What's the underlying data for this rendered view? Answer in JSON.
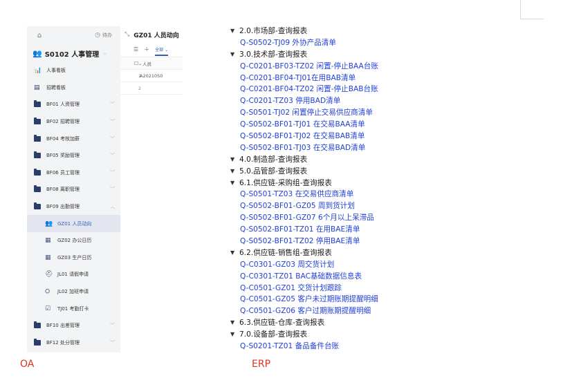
{
  "oa": {
    "todo_label": "待办",
    "system_title": "S0102 人事管理",
    "menu": [
      {
        "label": "人事看板",
        "icon": "chart-icon",
        "type": "top"
      },
      {
        "label": "招聘看板",
        "icon": "board-icon",
        "type": "top"
      },
      {
        "label": "BF01 人资管理",
        "icon": "folder-icon",
        "type": "folder",
        "chevron": "down"
      },
      {
        "label": "BF02 招聘管理",
        "icon": "folder-icon",
        "type": "folder",
        "chevron": "down"
      },
      {
        "label": "BF04 考核加薪",
        "icon": "folder-icon",
        "type": "folder",
        "chevron": "down"
      },
      {
        "label": "BF05 奖励管理",
        "icon": "folder-icon",
        "type": "folder",
        "chevron": "down"
      },
      {
        "label": "BF06 员工管理",
        "icon": "folder-icon",
        "type": "folder",
        "chevron": "down"
      },
      {
        "label": "BF08 离职管理",
        "icon": "folder-icon",
        "type": "folder",
        "chevron": "down"
      },
      {
        "label": "BF09 出勤管理",
        "icon": "folder-icon",
        "type": "folder",
        "chevron": "up"
      },
      {
        "label": "GZ01 人员动向",
        "icon": "people-icon",
        "type": "sub",
        "active": true
      },
      {
        "label": "GZ02 办公日历",
        "icon": "calendar-icon",
        "type": "sub"
      },
      {
        "label": "GZ03 生产日历",
        "icon": "calendar-icon",
        "type": "sub"
      },
      {
        "label": "JL01 请假申请",
        "icon": "user-leave-icon",
        "type": "sub"
      },
      {
        "label": "JL02 加班申请",
        "icon": "overtime-icon",
        "type": "sub"
      },
      {
        "label": "TJ01 考勤打卡",
        "icon": "checkin-icon",
        "type": "sub"
      },
      {
        "label": "BF10 出差管理",
        "icon": "folder-icon",
        "type": "folder",
        "chevron": "down"
      },
      {
        "label": "BF12 处分管理",
        "icon": "folder-icon",
        "type": "folder",
        "chevron": "down"
      }
    ],
    "content": {
      "title": "GZ01 人员动向",
      "tab_all": "全部",
      "column_person": "人员",
      "rows": [
        {
          "num": "1",
          "value": "A2021050"
        },
        {
          "num": "2",
          "value": ""
        }
      ]
    }
  },
  "erp": {
    "tree": [
      {
        "kind": "cat",
        "text": "2.0.市场部-查询报表"
      },
      {
        "kind": "link",
        "text": "Q-S0502-TJ09 外协产品清单"
      },
      {
        "kind": "cat",
        "text": "3.0.技术部-查询报表"
      },
      {
        "kind": "link",
        "text": "Q-C0201-BF03-TZ02 闲置-停止BAA台账"
      },
      {
        "kind": "link",
        "text": "Q-C0201-BF04-TJ01在用BAB清单"
      },
      {
        "kind": "link",
        "text": "Q-C0201-BF04-TZ02 闲置-停止BAB台账"
      },
      {
        "kind": "link",
        "text": "Q-C0201-TZ03 停用BAD清单"
      },
      {
        "kind": "link",
        "text": "Q-S0501-TJ02 闲置停止交易供应商清单"
      },
      {
        "kind": "link",
        "text": "Q-S0502-BF01-TJ01 在交易BAA清单"
      },
      {
        "kind": "link",
        "text": "Q-S0502-BF01-TJ02 在交易BAB清单"
      },
      {
        "kind": "link",
        "text": "Q-S0502-BF01-TJ03 在交易BAD清单"
      },
      {
        "kind": "cat",
        "text": "4.0.制造部-查询报表"
      },
      {
        "kind": "cat",
        "text": "5.0.品管部-查询报表"
      },
      {
        "kind": "cat",
        "text": "6.1.供应链-采购组-查询报表"
      },
      {
        "kind": "link",
        "text": "Q-S0501-TZ03 在交易供应商清单"
      },
      {
        "kind": "link",
        "text": "Q-S0502-BF01-GZ05 周到货计划"
      },
      {
        "kind": "link",
        "text": "Q-S0502-BF01-GZ07 6个月以上呆滞品"
      },
      {
        "kind": "link",
        "text": "Q-S0502-BF01-TZ01 在用BAE清单"
      },
      {
        "kind": "link",
        "text": "Q-S0502-BF01-TZ02 停用BAE清单"
      },
      {
        "kind": "cat",
        "text": "6.2.供应链-销售组-查询报表"
      },
      {
        "kind": "link",
        "text": "Q-C0301-GZ03 周交货计划"
      },
      {
        "kind": "link",
        "text": "Q-C0301-TZ01 BAC基础数据信息表"
      },
      {
        "kind": "link",
        "text": "Q-C0501-GZ01 交货计划跟踪"
      },
      {
        "kind": "link",
        "text": "Q-C0501-GZ05 客户未过期账期提醒明细"
      },
      {
        "kind": "link",
        "text": "Q-C0501-GZ06 客户过期账期提醒明细"
      },
      {
        "kind": "cat",
        "text": "6.3.供应链-仓库-查询报表"
      },
      {
        "kind": "cat",
        "text": "7.0.设备部-查询报表"
      },
      {
        "kind": "link",
        "text": "Q-S0201-TZ01 备品备件台账"
      }
    ]
  },
  "labels": {
    "oa": "OA",
    "erp": "ERP"
  },
  "colors": {
    "accent": "#2d5fbf",
    "link": "#1f3fd6",
    "label_red": "#e0341f",
    "sidebar_bg": "#f3f4f6"
  }
}
